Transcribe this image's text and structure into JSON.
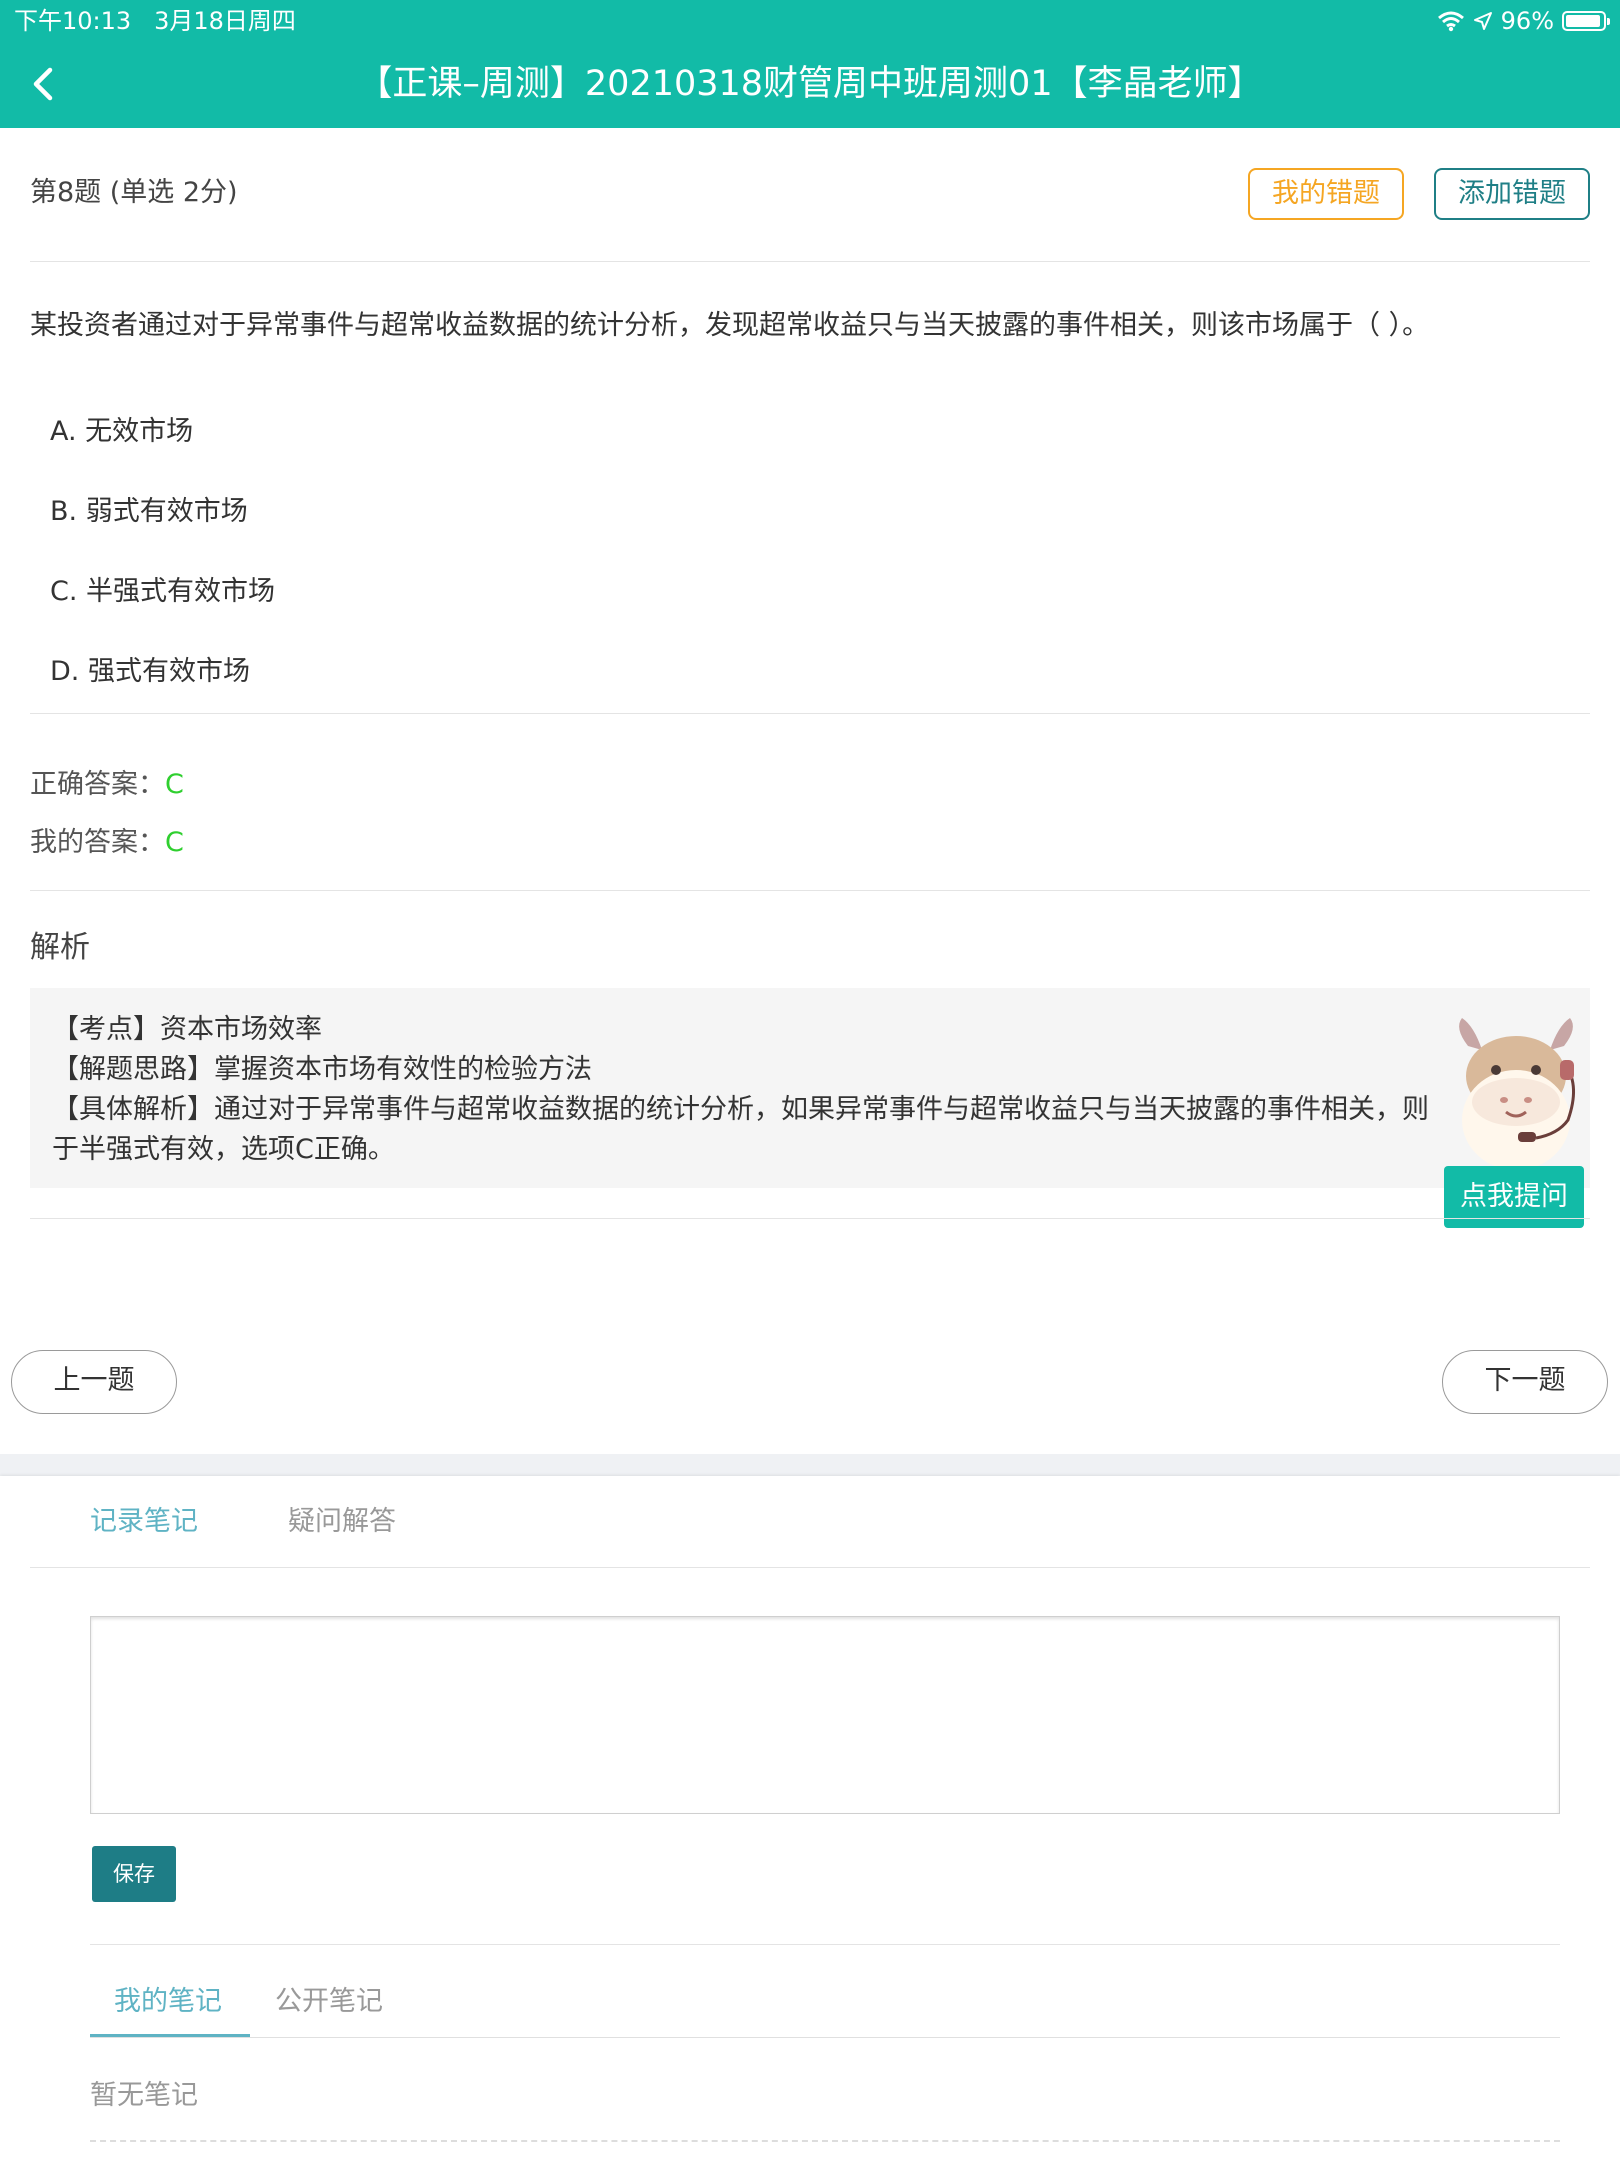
{
  "status_bar": {
    "time": "下午10:13",
    "date": "3月18日周四",
    "battery": "96%"
  },
  "header": {
    "title": "【正课–周测】20210318财管周中班周测01【李晶老师】"
  },
  "question": {
    "meta": "第8题 (单选  2分)",
    "my_errors_label": "我的错题",
    "add_error_label": "添加错题",
    "stem": "某投资者通过对于异常事件与超常收益数据的统计分析，发现超常收益只与当天披露的事件相关，则该市场属于（    ）。",
    "options": [
      "A. 无效市场",
      "B. 弱式有效市场",
      "C. 半强式有效市场",
      "D. 强式有效市场"
    ]
  },
  "answers": {
    "correct_label": "正确答案：",
    "correct_value": "C",
    "mine_label": "我的答案：",
    "mine_value": "C"
  },
  "analysis": {
    "title": "解析",
    "lines": [
      "【考点】资本市场效率",
      "【解题思路】掌握资本市场有效性的检验方法",
      "【具体解析】通过对于异常事件与超常收益数据的统计分析，如果异常事件与超常收益只与当天披露的事件相关，则",
      "于半强式有效，选项C正确。"
    ],
    "ask_label": "点我提问"
  },
  "navigation": {
    "prev_label": "上一题",
    "next_label": "下一题"
  },
  "notes": {
    "tab_record": "记录笔记",
    "tab_qa": "疑问解答",
    "save_label": "保存",
    "subtab_mine": "我的笔记",
    "subtab_public": "公开笔记",
    "empty_text": "暂无笔记"
  },
  "colors": {
    "header_bg": "#12bba7",
    "accent_orange": "#f5a623",
    "accent_teal_dark": "#1e7d86",
    "answer_green": "#2fcf2f",
    "tab_active": "#5fb3c4"
  },
  "icons": [
    "back-chevron-icon",
    "wifi-icon",
    "location-arrow-icon",
    "battery-icon",
    "cow-mascot-icon"
  ]
}
